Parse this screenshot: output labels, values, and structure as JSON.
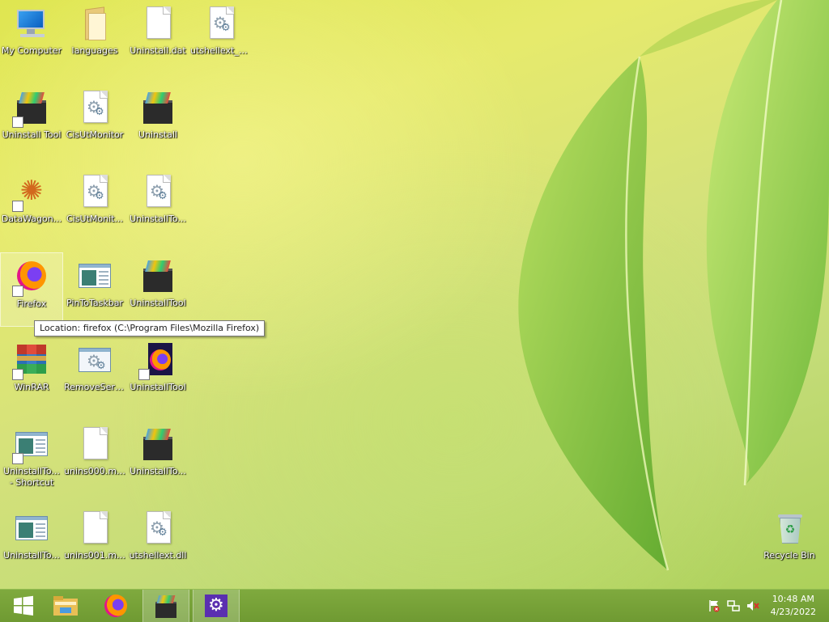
{
  "desktop": {
    "icons": [
      {
        "label": "My Computer",
        "icon": "computer-icon",
        "shortcut": false
      },
      {
        "label": "languages",
        "icon": "folder-icon",
        "shortcut": false
      },
      {
        "label": "Uninstall.dat",
        "icon": "blank-file-icon",
        "shortcut": false
      },
      {
        "label": "utshellext_x...",
        "icon": "settings-file-icon",
        "shortcut": false
      },
      {
        "label": "Uninstall Tool",
        "icon": "uninstall-tool-icon",
        "shortcut": true
      },
      {
        "label": "CisUtMonitor",
        "icon": "settings-file-icon",
        "shortcut": false
      },
      {
        "label": "Uninstall",
        "icon": "uninstall-tool-icon",
        "shortcut": false
      },
      {
        "label": "DataWagon...",
        "icon": "datawagon-icon",
        "shortcut": true
      },
      {
        "label": "CisUtMonit...",
        "icon": "settings-file-icon",
        "shortcut": false
      },
      {
        "label": "UninstallTo...",
        "icon": "settings-file-icon",
        "shortcut": false
      },
      {
        "label": "Firefox",
        "icon": "firefox-icon",
        "shortcut": true
      },
      {
        "label": "PinToTaskbar",
        "icon": "window-app-icon",
        "shortcut": false
      },
      {
        "label": "UninstallTool",
        "icon": "uninstall-tool-icon",
        "shortcut": false
      },
      {
        "label": "WinRAR",
        "icon": "winrar-icon",
        "shortcut": true
      },
      {
        "label": "RemoveServ...",
        "icon": "settings-app-icon",
        "shortcut": false
      },
      {
        "label": "UninstallTool",
        "icon": "firefox-dark-icon",
        "shortcut": true
      },
      {
        "label": "UninstallTo...\n- Shortcut",
        "icon": "window-app-icon",
        "shortcut": true
      },
      {
        "label": "unins000.msg",
        "icon": "blank-file-icon",
        "shortcut": false
      },
      {
        "label": "UninstallTo...",
        "icon": "uninstall-tool-icon",
        "shortcut": false
      },
      {
        "label": "UninstallTo...",
        "icon": "window-app-icon",
        "shortcut": false
      },
      {
        "label": "unins001.msg",
        "icon": "blank-file-icon",
        "shortcut": false
      },
      {
        "label": "utshellext.dll",
        "icon": "settings-file-icon",
        "shortcut": false
      },
      {
        "label": "Recycle Bin",
        "icon": "recycle-bin-icon",
        "shortcut": false
      }
    ],
    "selected_label": "Firefox",
    "tooltip": "Location: firefox (C:\\Program Files\\Mozilla Firefox)"
  },
  "taskbar": {
    "buttons": [
      {
        "name": "start-button",
        "icon": "windows-logo-icon"
      },
      {
        "name": "file-explorer-button",
        "icon": "file-explorer-icon"
      },
      {
        "name": "firefox-taskbar-button",
        "icon": "firefox-icon"
      },
      {
        "name": "uninstall-tool-taskbar-button",
        "icon": "uninstall-tool-icon"
      },
      {
        "name": "settings-taskbar-button",
        "icon": "gear-icon"
      }
    ],
    "tray_icons": [
      "action-center-flag-icon",
      "network-icon",
      "volume-muted-icon"
    ],
    "time": "10:48 AM",
    "date": "4/23/2022"
  }
}
